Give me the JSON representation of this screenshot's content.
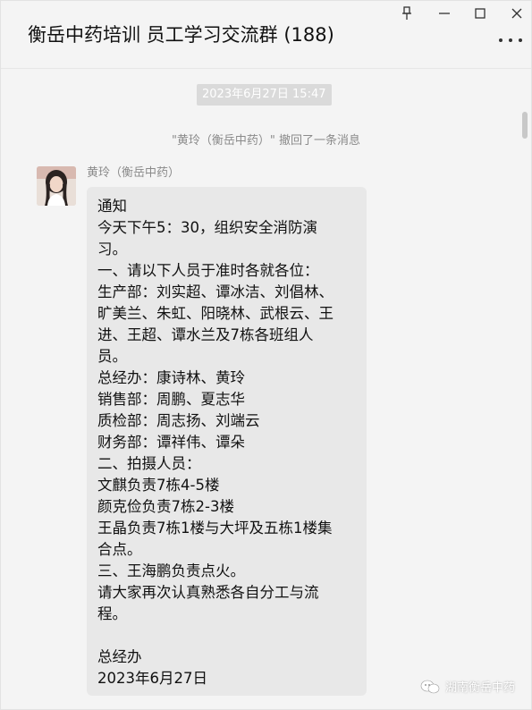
{
  "window": {
    "title": "衡岳中药培训 员工学习交流群 (188)",
    "controls": [
      "pin-icon",
      "minimize-icon",
      "maximize-icon",
      "close-icon"
    ],
    "more_icon": "more-dots-icon"
  },
  "chat": {
    "timestamp": "2023年6月27日 15:47",
    "recall_notice": "\"黄玲（衡岳中药）\" 撤回了一条消息",
    "message": {
      "sender": "黄玲（衡岳中药）",
      "lines": [
        "通知",
        "今天下午5：30，组织安全消防演",
        "习。",
        "一、请以下人员于准时各就各位：",
        "生产部：刘实超、谭冰洁、刘倡林、",
        "旷美兰、朱虹、阳晓林、武根云、王",
        "进、王超、谭水兰及7栋各班组人",
        "员。",
        "总经办：康诗林、黄玲",
        "销售部：周鹏、夏志华",
        "质检部：周志扬、刘端云",
        "财务部：谭祥伟、谭朵",
        "二、拍摄人员：",
        "文麒负责7栋4-5楼",
        "颜克俭负责7栋2-3楼",
        "王晶负责7栋1楼与大坪及五栋1楼集",
        "合点。",
        "三、王海鹏负责点火。",
        "请大家再次认真熟悉各自分工与流",
        "程。",
        "",
        "总经办",
        "2023年6月27日"
      ]
    }
  },
  "watermark": {
    "text": "湖南衡岳中药",
    "icon": "wechat-channel-icon"
  },
  "colors": {
    "background": "#f4f4f4",
    "bubble": "#e8e8e8",
    "timestamp_bg": "#dadada",
    "muted_text": "#8a8a8a"
  }
}
